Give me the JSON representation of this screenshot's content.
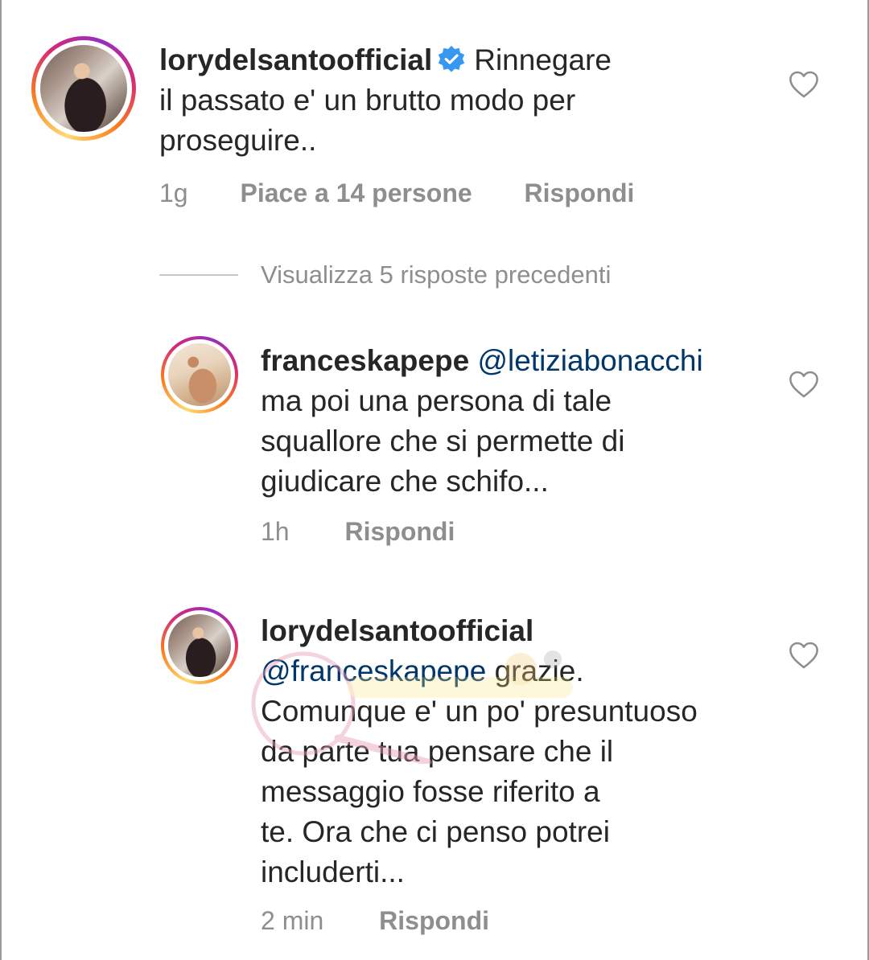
{
  "colors": {
    "text": "#262626",
    "muted": "#8e8e8e",
    "mention": "#00376b",
    "verified": "#3897f0"
  },
  "comments": [
    {
      "username": "lorydelsantoofficial",
      "verified": true,
      "text_line1": "Rinnegare",
      "text_line2": "il passato e' un brutto modo per",
      "text_line3": "proseguire..",
      "time": "1g",
      "likes": "Piace a 14 persone",
      "reply": "Rispondi",
      "avatar": "profile-photo",
      "like_icon": "heart-outline-icon"
    }
  ],
  "view_replies": "Visualizza 5 risposte precedenti",
  "replies": [
    {
      "username": "franceskapepe",
      "mention": "@letiziabonacchi",
      "lines": [
        "ma poi una persona di tale",
        "squallore che si permette di",
        "giudicare che schifo..."
      ],
      "time": "1h",
      "reply": "Rispondi",
      "avatar": "profile-photo",
      "like_icon": "heart-outline-icon"
    },
    {
      "username": "lorydelsantoofficial",
      "mention": "@franceskapepe",
      "first_line_rest": " grazie.",
      "lines": [
        "Comunque e' un po' presuntuoso",
        "da parte tua pensare che il",
        "messaggio fosse riferito a",
        "te. Ora che ci penso potrei",
        "includerti..."
      ],
      "time": "2 min",
      "reply": "Rispondi",
      "avatar": "profile-photo",
      "like_icon": "heart-outline-icon"
    }
  ]
}
